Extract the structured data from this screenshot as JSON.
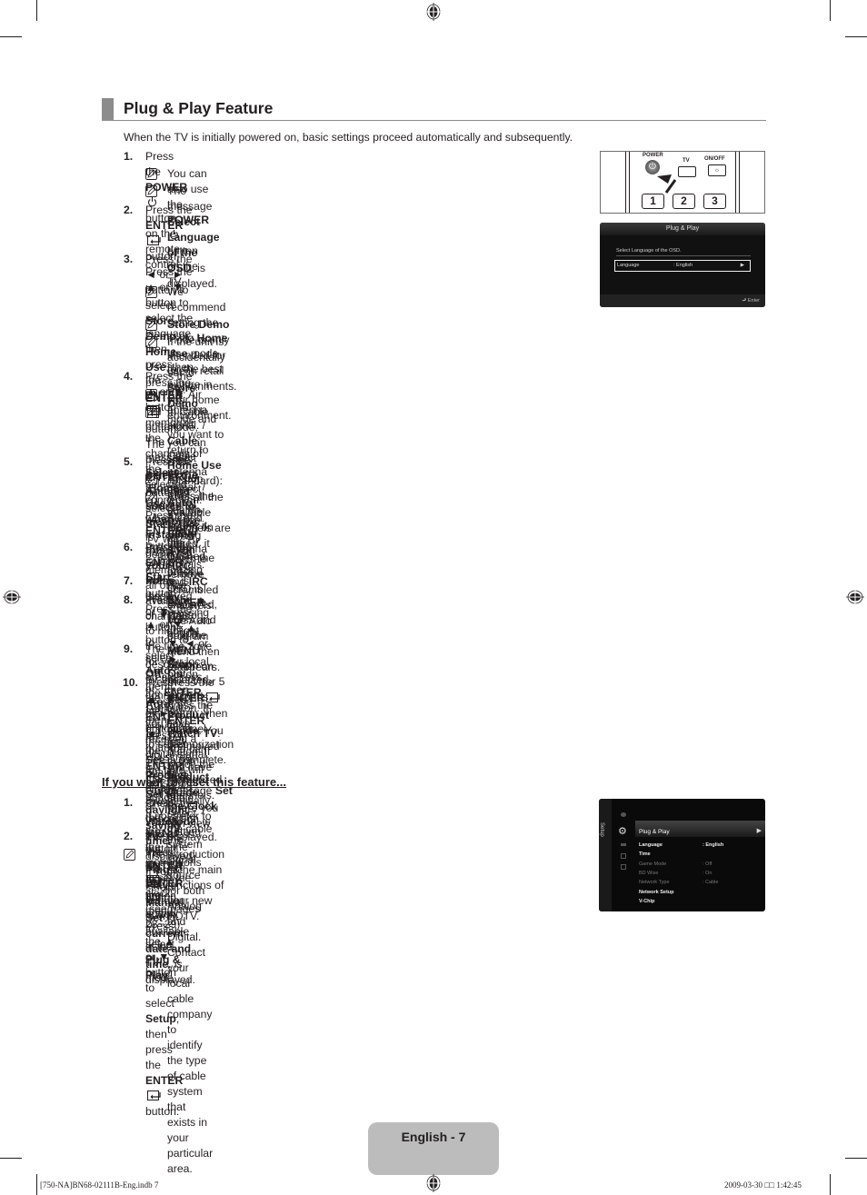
{
  "section_title": "Plug & Play Feature",
  "intro": "When the TV is initially powered on, basic settings proceed automatically and subsequently.",
  "steps": [
    {
      "num": "1."
    },
    {
      "num": "2."
    },
    {
      "num": "3."
    },
    {
      "num": "4."
    },
    {
      "num": "5."
    },
    {
      "num": "6."
    },
    {
      "num": "7."
    },
    {
      "num": "8."
    },
    {
      "num": "9."
    },
    {
      "num": "10."
    }
  ],
  "text": {
    "s1": [
      "Press the ",
      "POWER",
      " button on the remote control."
    ],
    "s1n1": [
      "You can also use the ",
      "POWER",
      " button on the TV."
    ],
    "s1n2": [
      "The message ",
      "Select Language of the OSD.",
      " is displayed."
    ],
    "s2a": [
      "Press the ",
      "ENTER",
      " button. Press the ▲ or ▼ button to select the language, then press"
    ],
    "s2b": [
      "the ",
      "ENTER",
      " button. The message ",
      "Select ‘Home Use’ when installing this TV in"
    ],
    "s2c": [
      "your home.",
      " is displayed."
    ],
    "s3a": [
      "Press the ◄ or ► button to select ",
      "Store Demo",
      " or ",
      "Home Use",
      ", then press the ",
      "ENTER"
    ],
    "s3b": [
      "button. The message ",
      "Select the Antenna source to memorize.",
      " is displayed."
    ],
    "s3n1a": [
      "We recommend setting the TV to ",
      "Home Use",
      " mode for the best picture in your home"
    ],
    "s3n1b": "environment.",
    "s3n2": [
      "Store Demo",
      " mode is only intended for use in retail environments."
    ],
    "s3n3a": [
      "If the unit is accidentally set to ",
      "Store Demo",
      " mode and you want to return to ",
      "Home Use",
      " (Standard): Press the volume"
    ],
    "s3n3b": [
      "button on the TV. When the volume OSD is displayed, press and hold the ",
      "MENU",
      " button on the TV for 5 seconds."
    ],
    "s4": [
      "Press the ▲ or ▼ button to memorize the channels of the selected connection. Press the ",
      "ENTER",
      " button to select ",
      "Start",
      "."
    ],
    "s4n1": [
      "Air",
      ": Air antenna signal. / ",
      "Cable",
      ": Cable antenna signal. / ",
      "Auto",
      ": Air and Cable antenna signals."
    ],
    "s4n2a": [
      "In Cable mode, you can select the correct signal source among ",
      "STD, HRC",
      ", and ",
      "IRC",
      " by pressing the ▲, ▼, ◄ or ►"
    ],
    "s4n2b": [
      "button, then press the ",
      "ENTER",
      " button. If you have Digital cable, select the cable system signal source for both Analog"
    ],
    "s4n2c": "and Digital. Contact your local cable company to identify the type of cable system that exists in your particular area.",
    "s5": [
      "Press the ",
      "ENTER",
      " button to select ",
      "Start",
      ". The TV will begin memorizing all of the available channels."
    ],
    "s5n1": [
      "To stop the search before it has finished, press the ",
      "ENTER",
      " button with ",
      "Stop",
      " selected."
    ],
    "s5n2a": "After all the available channels are stored, it starts to remove scrambled channels. The Auto program menu then",
    "s5n2b": [
      "reappears. Press the ",
      "ENTER",
      " button when channel memorization is complete. The message ",
      "Set the Clock Mode.",
      " is"
    ],
    "s5n2c": "displayed.",
    "s6a": [
      "Press the ",
      "ENTER",
      " button. Press the ▲ or ▼ button to select ",
      "Auto",
      ", then Press the ",
      "ENTER",
      " button. The message ",
      "Set to"
    ],
    "s6b": [
      "daylight saving time.",
      " is displayed. If you select ",
      "Manual, Set current date and time.",
      " is displayed."
    ],
    "s7": [
      "Press the ▲ or ▼ button to select ",
      "Off, On",
      " or ",
      "Auto",
      ", then press the ",
      "ENTER",
      " button."
    ],
    "s8a": [
      "Press the ▲ or ▼ button to highlight the time zone for your local area. Press the ",
      "ENTER",
      " button. If you have received a"
    ],
    "s8b": "digital signal, the time will be set automatically. If not, refer to the ‘Setting the Time’ instructions to set the clock.",
    "s8c": "(see pages 28~29)",
    "s9a": "The description for the connection method providing the best HD screen quality is displayed. Check the description and press",
    "s9b": [
      "the ",
      "ENTER",
      " button."
    ],
    "s10": [
      "Press the ◄ or ► button to select ",
      "See Product Guide",
      " or ",
      "Watch TV",
      ". Press the ",
      "ENTER",
      " button."
    ],
    "b1a": [
      "See Product Guide",
      ": You are moved to the ",
      "Product Guide",
      " where you can view the introduction to the main functions of"
    ],
    "b1b": "your new HDTV.",
    "b2": [
      "Watch TV",
      ": You can watch the memorized channels."
    ]
  },
  "reset": {
    "heading": "If you want to reset this feature...",
    "r1a": [
      "Press the ",
      "MENU",
      " button to display the menu. Press the ▲ or ▼ button to select ",
      "Setup",
      ","
    ],
    "r1b": [
      "then press the ",
      "ENTER",
      " button."
    ],
    "r2": [
      "Press the ",
      "ENTER",
      " button again to select ",
      "Plug & Play",
      "."
    ],
    "rn": [
      "The ",
      "Plug & Play",
      " feature is only available in the TV mode."
    ],
    "nums": [
      "1.",
      "2."
    ]
  },
  "remote_image": {
    "labels": {
      "power": "POWER",
      "tv": "TV",
      "onoff": "ON/OFF"
    },
    "keys": [
      "1",
      "2",
      "3"
    ]
  },
  "osd_plug_play": {
    "title": "Plug & Play",
    "message": "Select Language of the OSD.",
    "field_label": "Language",
    "field_value": ": English",
    "footer": "Enter"
  },
  "osd_setup": {
    "side_label": "Setup",
    "highlight": "Plug & Play",
    "rows": [
      {
        "label": "Language",
        "value": ": English",
        "dim": false
      },
      {
        "label": "Time",
        "value": "",
        "dim": false
      },
      {
        "label": "Game Mode",
        "value": ": Off",
        "dim": true
      },
      {
        "label": "BD Wise",
        "value": ": On",
        "dim": true
      },
      {
        "label": "Network Type",
        "value": ": Cable",
        "dim": true
      },
      {
        "label": "Network Setup",
        "value": "",
        "dim": false
      },
      {
        "label": "V-Chip",
        "value": "",
        "dim": false
      }
    ]
  },
  "footer": {
    "page_label": "English - 7",
    "slug_left": "[750-NA]BN68-02111B-Eng.indb   7",
    "slug_right": "2009-03-30   □□ 1:42:45"
  }
}
